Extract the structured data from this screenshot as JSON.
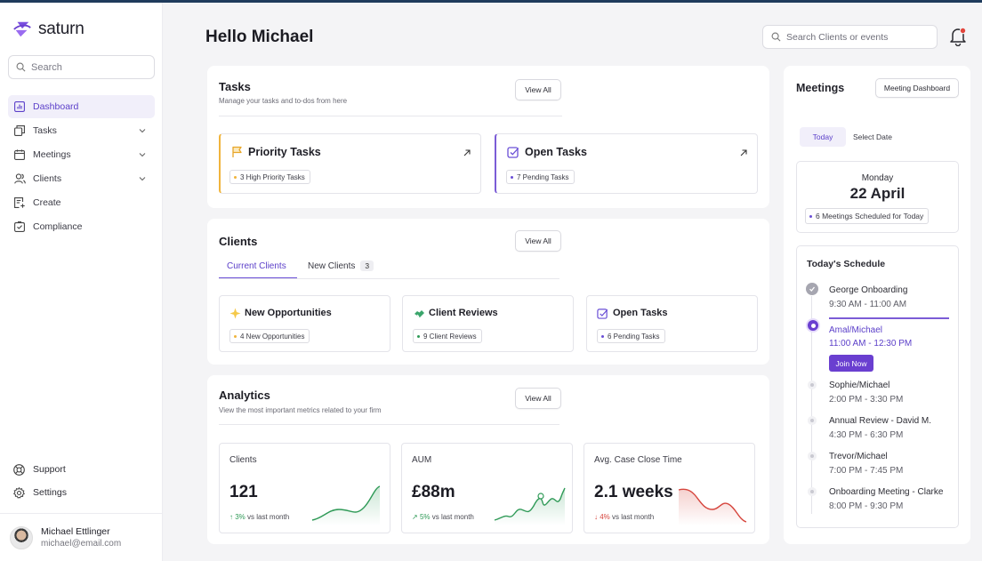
{
  "app": {
    "name": "saturn"
  },
  "sidebar": {
    "search_placeholder": "Search",
    "items": [
      {
        "label": "Dashboard",
        "icon": "chart-icon",
        "active": true
      },
      {
        "label": "Tasks",
        "icon": "tasks-icon",
        "expandable": true
      },
      {
        "label": "Meetings",
        "icon": "calendar-icon",
        "expandable": true
      },
      {
        "label": "Clients",
        "icon": "users-icon",
        "expandable": true
      },
      {
        "label": "Create",
        "icon": "create-icon"
      },
      {
        "label": "Compliance",
        "icon": "shield-check-icon"
      }
    ],
    "bottom": [
      {
        "label": "Support",
        "icon": "lifebuoy-icon"
      },
      {
        "label": "Settings",
        "icon": "gear-icon"
      }
    ],
    "user": {
      "name": "Michael Ettlinger",
      "email": "michael@email.com"
    }
  },
  "header": {
    "greeting": "Hello Michael",
    "search_placeholder": "Search Clients or events"
  },
  "tasks": {
    "title": "Tasks",
    "subtitle": "Manage your tasks and to-dos from here",
    "view_all": "View All",
    "cards": [
      {
        "title": "Priority Tasks",
        "chip": "3 High Priority Tasks",
        "accent": "#f0b43c"
      },
      {
        "title": "Open Tasks",
        "chip": "7 Pending Tasks",
        "accent": "#7b5cd6"
      }
    ]
  },
  "clients": {
    "title": "Clients",
    "view_all": "View All",
    "tabs": [
      {
        "label": "Current Clients",
        "active": true
      },
      {
        "label": "New Clients",
        "badge": "3"
      }
    ],
    "cards": [
      {
        "title": "New Opportunities",
        "chip": "4 New Opportunities",
        "dot": "#f0b43c"
      },
      {
        "title": "Client Reviews",
        "chip": "9 Client Reviews",
        "dot": "#2f9a57"
      },
      {
        "title": "Open Tasks",
        "chip": "6 Pending Tasks",
        "dot": "#6a4fd6"
      }
    ]
  },
  "analytics": {
    "title": "Analytics",
    "subtitle": "View the most important metrics related to your firm",
    "view_all": "View All",
    "metrics": [
      {
        "label": "Clients",
        "value": "121",
        "change": "3%",
        "direction": "up",
        "suffix": "vs last month",
        "color": "#2f9a57"
      },
      {
        "label": "AUM",
        "value": "£88m",
        "change": "5%",
        "direction": "up",
        "suffix": "vs last month",
        "color": "#2f9a57"
      },
      {
        "label": "Avg. Case Close Time",
        "value": "2.1 weeks",
        "change": "4%",
        "direction": "down",
        "suffix": "vs last month",
        "color": "#d6453d"
      }
    ]
  },
  "meetings": {
    "title": "Meetings",
    "dashboard_button": "Meeting Dashboard",
    "segments": [
      "Today",
      "Select Date"
    ],
    "day": "Monday",
    "date": "22 April",
    "scheduled": "6 Meetings Scheduled for Today",
    "schedule_title": "Today's Schedule",
    "join_label": "Join Now",
    "schedule": [
      {
        "title": "George Onboarding",
        "time": "9:30 AM - 11:00 AM",
        "status": "done"
      },
      {
        "title": "Amal/Michael",
        "time": "11:00 AM - 12:30 PM",
        "status": "current"
      },
      {
        "title": "Sophie/Michael",
        "time": "2:00 PM - 3:30 PM",
        "status": "upcoming"
      },
      {
        "title": "Annual Review - David M.",
        "time": "4:30 PM - 6:30 PM",
        "status": "upcoming"
      },
      {
        "title": "Trevor/Michael",
        "time": "7:00 PM - 7:45 PM",
        "status": "upcoming"
      },
      {
        "title": "Onboarding Meeting - Clarke",
        "time": "8:00 PM - 9:30 PM",
        "status": "upcoming"
      }
    ]
  },
  "colors": {
    "accent": "#6a4fd6",
    "positive": "#2f9a57",
    "negative": "#d6453d",
    "priority": "#f0b43c"
  }
}
